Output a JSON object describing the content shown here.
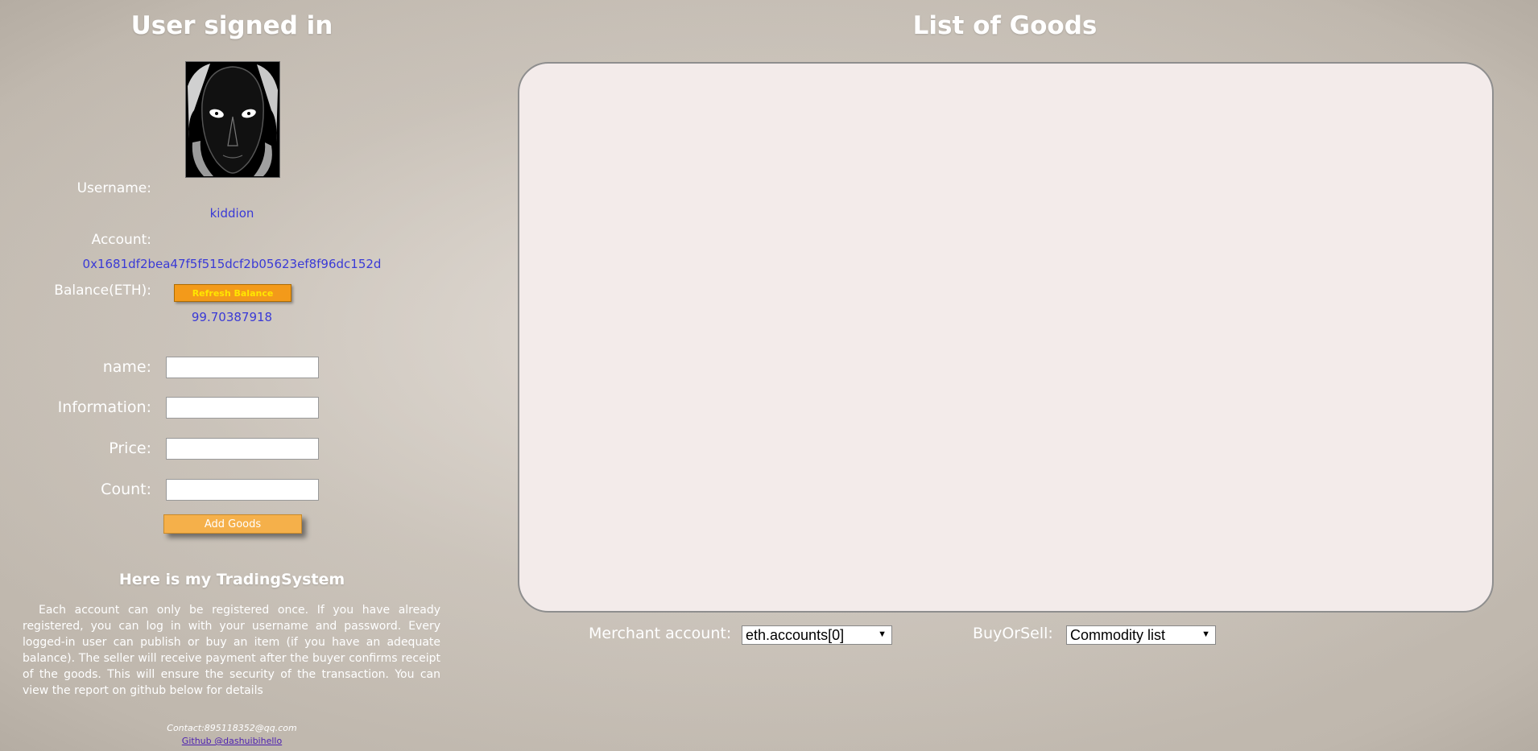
{
  "left_panel": {
    "title": "User signed in",
    "avatar_alt": "avatar",
    "username_label": "Username:",
    "username": "kiddion",
    "account_label": "Account:",
    "account": "0x1681df2bea47f5f515dcf2b05623ef8f96dc152d",
    "balance_label": "Balance(ETH):",
    "refresh_button": "Refresh Balance",
    "balance": "99.70387918"
  },
  "goods_form": {
    "name_label": "name:",
    "name_value": "",
    "information_label": "Information:",
    "information_value": "",
    "price_label": "Price:",
    "price_value": "",
    "count_label": "Count:",
    "count_value": "",
    "add_button": "Add Goods"
  },
  "about": {
    "title": "Here is my TradingSystem",
    "text": "Each account can only be registered once. If you have already registered, you can log in with your username and password. Every logged-in user can publish or buy an item (if you have an adequate balance). The seller will receive payment after the buyer confirms receipt of the goods. This will ensure the security of the transaction. You can view the report on github below for details",
    "contact": "Contact:895118352@qq.com",
    "github": "Github @dashuibihello"
  },
  "right_panel": {
    "title": "List of Goods",
    "goods": [],
    "merchant_label": "Merchant account:",
    "merchant_selected": "eth.accounts[0]",
    "buyorsell_label": "BuyOrSell:",
    "buyorsell_selected": "Commodity list"
  },
  "colors": {
    "value_text": "#3a3ad6",
    "refresh_button_bg": "#f39a1a",
    "refresh_button_text": "#ffe600",
    "add_button_bg": "#f5b04a",
    "panel_bg": "#f3ebea"
  }
}
